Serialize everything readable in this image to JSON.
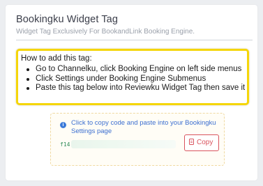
{
  "card": {
    "title": "Bookingku Widget Tag",
    "subtitle": "Widget Tag Exclusively For BookandLink Booking Engine."
  },
  "howto": {
    "title": "How to add this tag:",
    "steps": [
      "Go to Channelku, click Booking Engine on left side menus",
      "Click Settings under Booking Engine Submenus",
      "Paste this tag below into Reviewku Widget Tag then save it"
    ],
    "highlight_color": "#f5d60a"
  },
  "copy_box": {
    "info_icon": "info-circle-icon",
    "instruction": "Click to copy code and paste into your Bookingku Settings page",
    "code_prefix": "f14",
    "copy_button_label": "Copy",
    "copy_icon": "copy-document-icon",
    "accent_color": "#d9535d"
  }
}
